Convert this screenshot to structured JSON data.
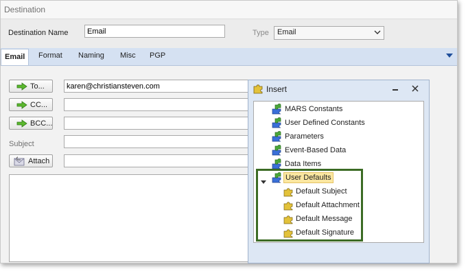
{
  "window": {
    "title": "Destination"
  },
  "form": {
    "name_label": "Destination Name",
    "name_value": "Email",
    "type_label": "Type",
    "type_value": "Email"
  },
  "tabs": [
    {
      "label": "Email",
      "active": true
    },
    {
      "label": "Format"
    },
    {
      "label": "Naming"
    },
    {
      "label": "Misc"
    },
    {
      "label": "PGP"
    }
  ],
  "email": {
    "to_label": "To...",
    "to_value": "karen@christiansteven.com",
    "cc_label": "CC...",
    "cc_value": "",
    "bcc_label": "BCC...",
    "bcc_value": "",
    "subject_label": "Subject",
    "subject_value": "",
    "attach_label": "Attach",
    "attach_value": ""
  },
  "insert_panel": {
    "title": "Insert",
    "nodes": [
      {
        "label": "MARS Constants",
        "icon": "puzzle-icon"
      },
      {
        "label": "User Defined Constants",
        "icon": "puzzle-icon"
      },
      {
        "label": "Parameters",
        "icon": "puzzle-icon"
      },
      {
        "label": "Event-Based Data",
        "icon": "puzzle-icon"
      },
      {
        "label": "Data Items",
        "icon": "puzzle-icon"
      },
      {
        "label": "User Defaults",
        "icon": "puzzle-icon",
        "selected": true,
        "expanded": true,
        "children": [
          {
            "label": "Default Subject",
            "icon": "puzzle-piece-icon"
          },
          {
            "label": "Default Attachment",
            "icon": "puzzle-piece-icon"
          },
          {
            "label": "Default Message",
            "icon": "puzzle-piece-icon"
          },
          {
            "label": "Default Signature",
            "icon": "puzzle-piece-icon"
          }
        ]
      }
    ]
  },
  "colors": {
    "highlight_border": "#3b6b24",
    "tab_bar": "#d5e1f2",
    "selection": "#fbe7a1"
  }
}
